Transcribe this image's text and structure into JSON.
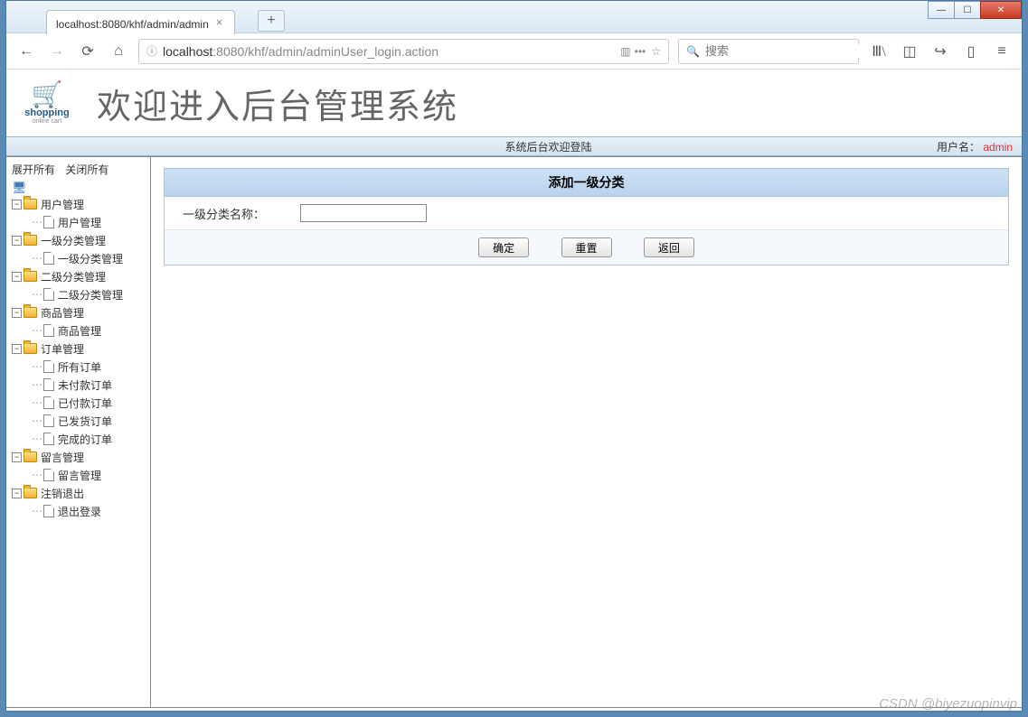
{
  "window": {
    "tab_title": "localhost:8080/khf/admin/admin",
    "url_prefix": "localhost",
    "url_suffix": ":8080/khf/admin/adminUser_login.action",
    "search_placeholder": "搜索"
  },
  "logo": {
    "brand": "shopping",
    "sub": "online cart"
  },
  "header_title": "欢迎进入后台管理系统",
  "statusbar": {
    "center": "系统后台欢迎登陆",
    "user_label": "用户名：",
    "username": "admin"
  },
  "sidebar": {
    "expand_all": "展开所有",
    "collapse_all": "关闭所有",
    "groups": [
      {
        "label": "用户管理",
        "children": [
          {
            "label": "用户管理"
          }
        ]
      },
      {
        "label": "一级分类管理",
        "children": [
          {
            "label": "一级分类管理"
          }
        ]
      },
      {
        "label": "二级分类管理",
        "children": [
          {
            "label": "二级分类管理"
          }
        ]
      },
      {
        "label": "商品管理",
        "children": [
          {
            "label": "商品管理"
          }
        ]
      },
      {
        "label": "订单管理",
        "children": [
          {
            "label": "所有订单"
          },
          {
            "label": "未付款订单"
          },
          {
            "label": "已付款订单"
          },
          {
            "label": "已发货订单"
          },
          {
            "label": "完成的订单"
          }
        ]
      },
      {
        "label": "留言管理",
        "children": [
          {
            "label": "留言管理"
          }
        ]
      },
      {
        "label": "注销退出",
        "children": [
          {
            "label": "退出登录"
          }
        ]
      }
    ]
  },
  "form": {
    "title": "添加一级分类",
    "field_label": "一级分类名称：",
    "field_value": "",
    "btn_ok": "确定",
    "btn_reset": "重置",
    "btn_back": "返回"
  },
  "watermark": "CSDN @biyezuopinvip"
}
